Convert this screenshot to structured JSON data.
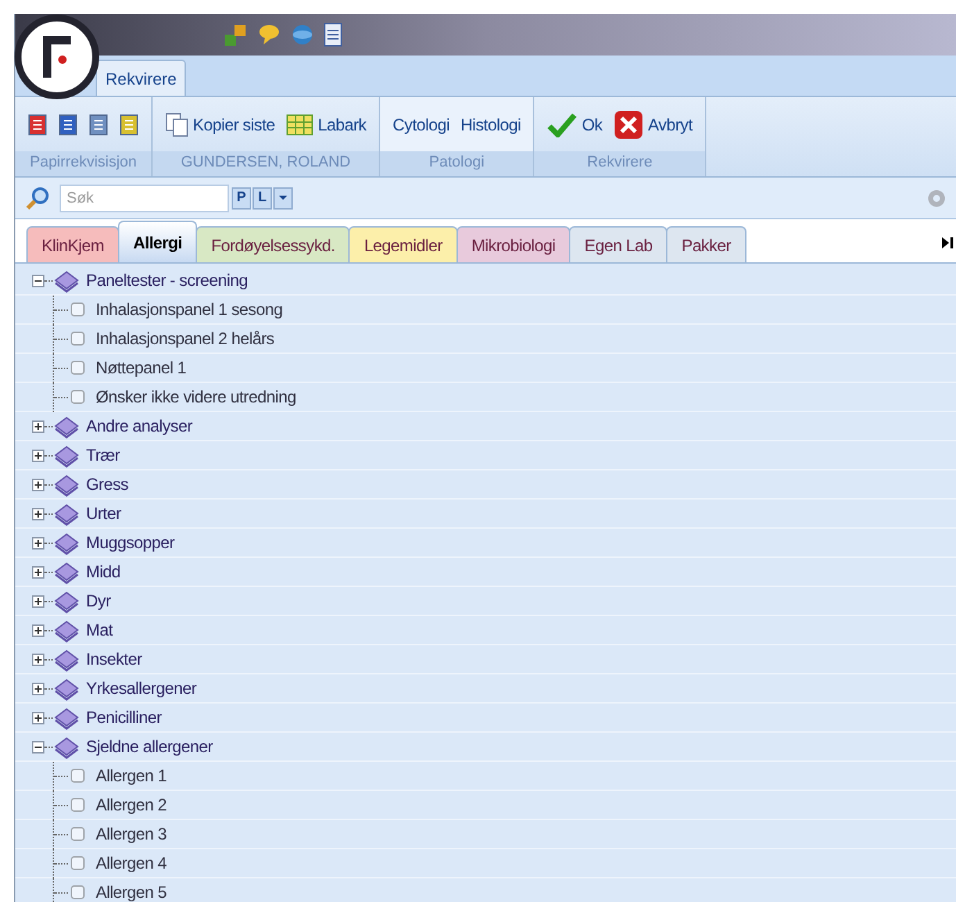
{
  "ribbon_tab": {
    "label": "Rekvirere",
    "selected": true
  },
  "ribbon_groups": [
    {
      "title": "Papirrekvisisjon",
      "buttons": [
        {
          "kind": "form",
          "color": "#d83030"
        },
        {
          "kind": "form",
          "color": "#3060c0"
        },
        {
          "kind": "form",
          "color": "#7090c0"
        },
        {
          "kind": "form",
          "color": "#d8c030"
        }
      ]
    },
    {
      "title": "GUNDERSEN, ROLAND",
      "buttons": [
        {
          "kind": "copy",
          "label": "Kopier siste"
        },
        {
          "kind": "sheet",
          "label": "Labark"
        }
      ]
    },
    {
      "title": "Patologi",
      "buttons": [
        {
          "kind": "text",
          "label": "Cytologi"
        },
        {
          "kind": "text",
          "label": "Histologi"
        }
      ]
    },
    {
      "title": "Rekvirere",
      "buttons": [
        {
          "kind": "ok",
          "label": "Ok"
        },
        {
          "kind": "cancel",
          "label": "Avbryt"
        }
      ]
    }
  ],
  "search": {
    "placeholder": "Søk",
    "buttons": [
      "P",
      "L"
    ]
  },
  "tabs": [
    {
      "label": "KlinKjem",
      "selected": false,
      "color": "#f6bcbc"
    },
    {
      "label": "Allergi",
      "selected": true,
      "color": "#c8daf2"
    },
    {
      "label": "Fordøyelsessykd.",
      "selected": false,
      "color": "#d8e8c4"
    },
    {
      "label": "Legemidler",
      "selected": false,
      "color": "#fcefaa"
    },
    {
      "label": "Mikrobiologi",
      "selected": false,
      "color": "#e8cadc"
    },
    {
      "label": "Egen Lab",
      "selected": false,
      "color": "#dde6f0"
    },
    {
      "label": "Pakker",
      "selected": false,
      "color": "#dde6f0"
    }
  ],
  "tree": [
    {
      "label": "Paneltester - screening",
      "expanded": true,
      "children": [
        {
          "label": "Inhalasjonspanel 1 sesong",
          "checked": false
        },
        {
          "label": "Inhalasjonspanel 2 helårs",
          "checked": false
        },
        {
          "label": "Nøttepanel 1",
          "checked": false
        },
        {
          "label": "Ønsker ikke videre utredning",
          "checked": false
        }
      ]
    },
    {
      "label": "Andre analyser",
      "expanded": false
    },
    {
      "label": "Trær",
      "expanded": false
    },
    {
      "label": "Gress",
      "expanded": false
    },
    {
      "label": "Urter",
      "expanded": false
    },
    {
      "label": "Muggsopper",
      "expanded": false
    },
    {
      "label": "Midd",
      "expanded": false
    },
    {
      "label": "Dyr",
      "expanded": false
    },
    {
      "label": "Mat",
      "expanded": false
    },
    {
      "label": "Insekter",
      "expanded": false
    },
    {
      "label": "Yrkesallergener",
      "expanded": false
    },
    {
      "label": "Penicilliner",
      "expanded": false
    },
    {
      "label": "Sjeldne allergener",
      "expanded": true,
      "children": [
        {
          "label": "Allergen 1",
          "checked": false
        },
        {
          "label": "Allergen 2",
          "checked": false
        },
        {
          "label": "Allergen 3",
          "checked": false
        },
        {
          "label": "Allergen 4",
          "checked": false
        },
        {
          "label": "Allergen 5",
          "checked": false
        }
      ]
    }
  ]
}
